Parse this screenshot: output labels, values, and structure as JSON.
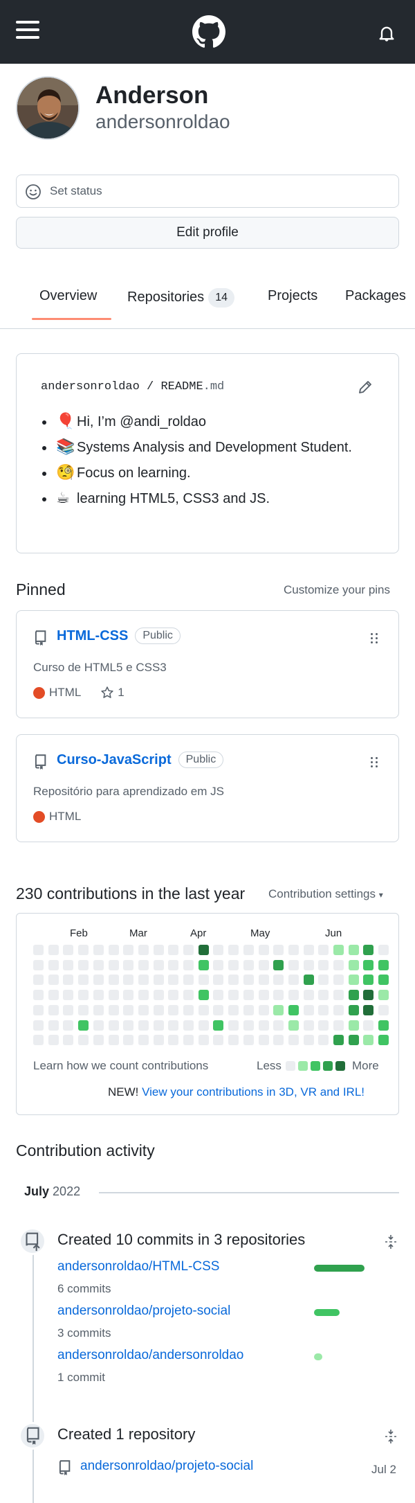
{
  "colors": {
    "header_bg": "#24292f",
    "link": "#0969da",
    "accent_tab": "#fd8c73",
    "html_lang": "#e34c26",
    "green_1": "#9be9a8",
    "green_2": "#40c463",
    "green_3": "#30a14e",
    "green_4": "#216e39",
    "empty": "#ebedf0"
  },
  "header": {
    "menu_icon": "hamburger-icon",
    "logo_icon": "github-mark-icon",
    "notification_icon": "bell-icon"
  },
  "profile": {
    "name": "Anderson",
    "login": "andersonroldao",
    "set_status": "Set status",
    "edit_profile": "Edit profile"
  },
  "tabs": [
    {
      "label": "Overview"
    },
    {
      "label": "Repositories",
      "count": "14"
    },
    {
      "label": "Projects"
    },
    {
      "label": "Packages"
    }
  ],
  "readme": {
    "owner": "andersonroldao",
    "sep": " / ",
    "file": "README",
    "ext": ".md",
    "items": [
      {
        "emoji": "🎈",
        "text": "Hi, I’m @andi_roldao"
      },
      {
        "emoji": "📚",
        "text": "Systems Analysis and Development Student."
      },
      {
        "emoji": "🧐",
        "text": "Focus on learning."
      },
      {
        "emoji": "☕",
        "text": "learning HTML5, CSS3 and JS."
      }
    ]
  },
  "pinned": {
    "title": "Pinned",
    "customize": "Customize your pins",
    "repos": [
      {
        "name": "HTML-CSS",
        "visibility": "Public",
        "description": "Curso de HTML5 e CSS3",
        "language": "HTML",
        "stars": "1"
      },
      {
        "name": "Curso-JavaScript",
        "visibility": "Public",
        "description": "Repositório para aprendizado em JS",
        "language": "HTML"
      }
    ]
  },
  "contributions": {
    "title": "230 contributions in the last year",
    "settings": "Contribution settings",
    "months": [
      "Feb",
      "Mar",
      "Apr",
      "May",
      "Jun"
    ],
    "grid_levels": [
      [
        0,
        0,
        0,
        0,
        0,
        0,
        0,
        0,
        0,
        0,
        0,
        4,
        0,
        0,
        0,
        0,
        0,
        0,
        0,
        0,
        1,
        1,
        3,
        0
      ],
      [
        0,
        0,
        0,
        0,
        0,
        0,
        0,
        0,
        0,
        0,
        0,
        2,
        0,
        0,
        0,
        0,
        3,
        0,
        0,
        0,
        0,
        1,
        2,
        2
      ],
      [
        0,
        0,
        0,
        0,
        0,
        0,
        0,
        0,
        0,
        0,
        0,
        0,
        0,
        0,
        0,
        0,
        0,
        0,
        3,
        0,
        0,
        1,
        2,
        2
      ],
      [
        0,
        0,
        0,
        0,
        0,
        0,
        0,
        0,
        0,
        0,
        0,
        2,
        0,
        0,
        0,
        0,
        0,
        0,
        0,
        0,
        0,
        3,
        4,
        1
      ],
      [
        0,
        0,
        0,
        0,
        0,
        0,
        0,
        0,
        0,
        0,
        0,
        0,
        0,
        0,
        0,
        0,
        1,
        2,
        0,
        0,
        0,
        3,
        4,
        0
      ],
      [
        0,
        0,
        0,
        2,
        0,
        0,
        0,
        0,
        0,
        0,
        0,
        0,
        2,
        0,
        0,
        0,
        0,
        1,
        0,
        0,
        0,
        1,
        0,
        2
      ],
      [
        0,
        0,
        0,
        0,
        0,
        0,
        0,
        0,
        0,
        0,
        0,
        0,
        0,
        0,
        0,
        0,
        0,
        0,
        0,
        0,
        3,
        3,
        1,
        2
      ]
    ],
    "learn": "Learn how we count contributions",
    "less": "Less",
    "more": "More",
    "new_prefix": "NEW! ",
    "new_link": "View your contributions in 3D, VR and IRL!"
  },
  "activity": {
    "title": "Contribution activity",
    "month": "July",
    "year": "2022",
    "commits_title": "Created 10 commits in 3 repositories",
    "commit_repos": [
      {
        "repo": "andersonroldao/HTML-CSS",
        "count": "6 commits",
        "share": 0.6
      },
      {
        "repo": "andersonroldao/projeto-social",
        "count": "3 commits",
        "share": 0.3
      },
      {
        "repo": "andersonroldao/andersonroldao",
        "count": "1 commit",
        "share": 0.1
      }
    ],
    "repo_title": "Created 1 repository",
    "created_repo": "andersonroldao/projeto-social",
    "created_date": "Jul 2"
  }
}
